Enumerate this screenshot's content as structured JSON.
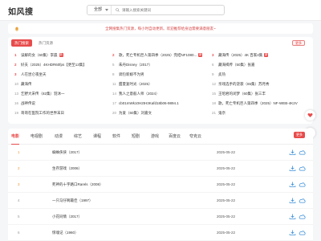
{
  "header": {
    "logo": "如风搜",
    "search_select": "全部",
    "search_placeholder": "请输入搜索关键词"
  },
  "notice": {
    "text": "全网搜集热门资源，每小时自动更新。欢迎推荐给身边需要满意朋友~"
  },
  "hot": {
    "badge": "热门搜索",
    "subtitle": "热门资源",
    "more": "更多",
    "columns": [
      [
        {
          "rank": "1",
          "title": "误解的女（60集）李晨",
          "tag": "新"
        },
        {
          "rank": "2",
          "title": "好夫（2025）4KHDR60fps【更至13集】",
          "tag": ""
        },
        {
          "rank": "3",
          "title": "人在昆仑夜坐天",
          "tag": ""
        },
        {
          "rank": "10",
          "title": "藏海传",
          "tag": ""
        },
        {
          "rank": "13",
          "title": "乞野大宋传（82集）羽沐一",
          "tag": ""
        },
        {
          "rank": "16",
          "title": "战神传说",
          "tag": ""
        },
        {
          "rank": "19",
          "title": "哥哥在医院工作的世界末日",
          "tag": ""
        }
      ],
      [
        {
          "rank": "2",
          "title": "歌，死亡专机巨人第四季（2025）完结NF1080...",
          "tag": "新"
        },
        {
          "rank": "5",
          "title": "朱丹Disney（2017）",
          "tag": ""
        },
        {
          "rank": "8",
          "title": "调包新娘不为男",
          "tag": ""
        },
        {
          "rank": "11",
          "title": "甜夏复时光（2025）",
          "tag": ""
        },
        {
          "rank": "14",
          "title": "我人之意般人师（2024）",
          "tag": ""
        },
        {
          "rank": "17",
          "title": "cb01mWk10H2tH3Kafd18b06-9894.1",
          "tag": ""
        },
        {
          "rank": "20",
          "title": "为爱（60集）刘嘉文",
          "tag": ""
        }
      ],
      [
        {
          "rank": "3",
          "title": "藏海传（2025）4K 百家4集",
          "tag": "新"
        },
        {
          "rank": "6",
          "title": "藏海揭传（50集）张嘉",
          "tag": ""
        },
        {
          "rank": "9",
          "title": "炙热",
          "tag": ""
        },
        {
          "rank": "12",
          "title": "亲戏选手的逆袭（65集）苏月秀",
          "tag": ""
        },
        {
          "rank": "15",
          "title": "王昭君的闭梦（60集）张三丰",
          "tag": ""
        },
        {
          "rank": "18",
          "title": "歌，死亡专机巨人第四季（2025）NF-WEB-4K2V",
          "tag": ""
        },
        {
          "rank": "21",
          "title": "鬼奈",
          "tag": ""
        }
      ]
    ]
  },
  "tabs": [
    "电影",
    "电视剧",
    "动漫",
    "综艺",
    "课程",
    "软件",
    "短剧",
    "游戏",
    "百度云",
    "夸克云"
  ],
  "list_more": "更多",
  "rows": [
    {
      "rank": "1",
      "title": "蜘蛛侠侠（2017）",
      "date": "2025-05-22"
    },
    {
      "rank": "2",
      "title": "生存游戏（2006）",
      "date": "2025-05-22"
    },
    {
      "rank": "3",
      "title": "死神的十字路口Rarels（2008）",
      "date": "2025-05-22"
    },
    {
      "rank": "4",
      "title": "一只马仔啊最佳（1997）",
      "date": "2025-05-22"
    },
    {
      "rank": "5",
      "title": "小花同情（2017）",
      "date": "2025-05-22"
    },
    {
      "rank": "6",
      "title": "惊魂记（1960）",
      "date": "2025-05-22"
    }
  ],
  "colors": {
    "accent": "#e84b4b",
    "notice_text": "#d64545",
    "rank_top": "#e89a3c"
  },
  "icons": [
    "search-icon",
    "bell-icon",
    "heart-icon",
    "arrow-up-icon",
    "download-icon",
    "cloud-icon"
  ]
}
